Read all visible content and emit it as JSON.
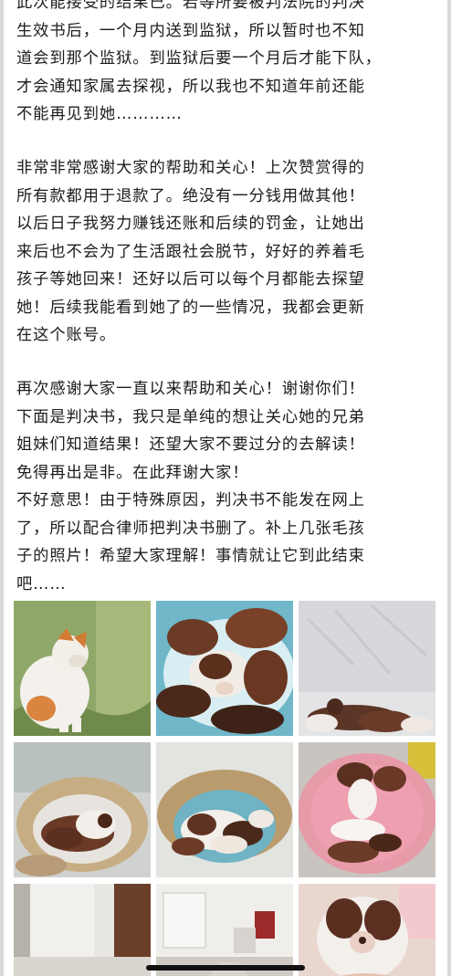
{
  "post": {
    "paragraphs": [
      "此次能接受的结果已。若等所要被判法院的判决\n生效书后，一个月内送到监狱，所以暂时也不知\n道会到那个监狱。到监狱后要一个月后才能下队，\n才会通知家属去探视，所以我也不知道年前还能\n不能再见到她…………",
      "非常非常感谢大家的帮助和关心！上次赞赏得的\n所有款都用于退款了。绝没有一分钱用做其他！\n以后日子我努力赚钱还账和后续的罚金，让她出\n来后也不会为了生活跟社会脱节，好好的养着毛\n孩子等她回来！还好以后可以每个月都能去探望\n她！后续我能看到她了的一些情况，我都会更新\n在这个账号。",
      "再次感谢大家一直以来帮助和关心！谢谢你们！\n下面是判决书，我只是单纯的想让关心她的兄弟\n姐妹们知道结果！还望大家不要过分的去解读！\n免得再出是非。在此拜谢大家！\n不好意思！由于特殊原因，判决书不能发在网上\n了，所以配合律师把判决书删了。补上几张毛孩\n子的照片！希望大家理解！事情就让它到此结束\n吧……"
    ],
    "photos": [
      {
        "subject": "dog-on-grass-photo"
      },
      {
        "subject": "puppies-on-blanket-photo"
      },
      {
        "subject": "puppies-by-wall-photo"
      },
      {
        "subject": "puppies-in-bed-photo"
      },
      {
        "subject": "puppies-in-bed-closeup-photo"
      },
      {
        "subject": "puppies-on-pink-rug-photo"
      },
      {
        "subject": "puppies-in-hallway-photo"
      },
      {
        "subject": "room-with-puppies-photo"
      },
      {
        "subject": "puppy-held-in-hand-photo"
      }
    ]
  },
  "colors": {
    "text": "#1c1c1c",
    "background": "#ffffff",
    "home_indicator": "#111111"
  }
}
